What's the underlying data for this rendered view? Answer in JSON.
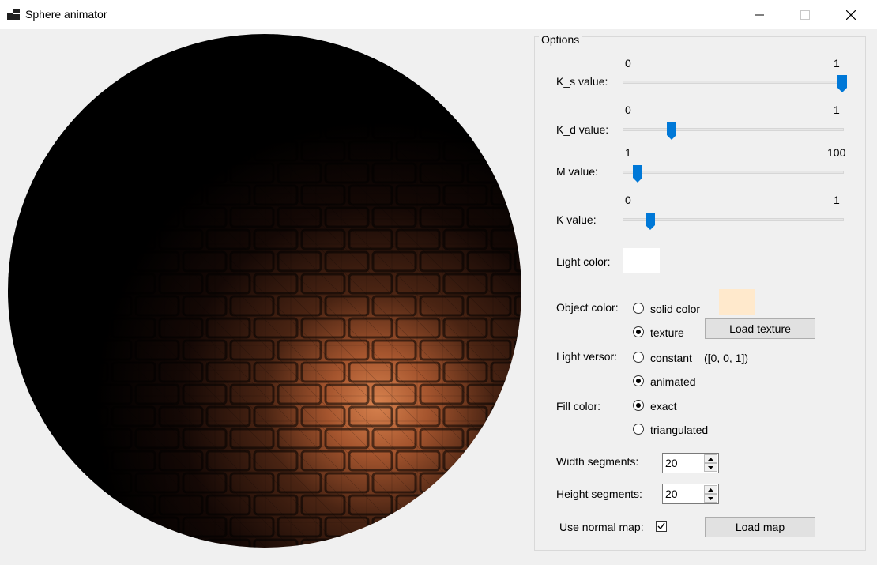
{
  "window": {
    "title": "Sphere animator",
    "controls": {
      "minimize": "—",
      "maximize": "☐",
      "close": "✕"
    }
  },
  "options": {
    "group_label": "Options",
    "sliders": [
      {
        "label": "K_s value:",
        "min_label": "0",
        "max_label": "1",
        "value": 1.0
      },
      {
        "label": "K_d value:",
        "min_label": "0",
        "max_label": "1",
        "value": 0.2
      },
      {
        "label": "M value:",
        "min_label": "1",
        "max_label": "100",
        "value": 5
      },
      {
        "label": "K value:",
        "min_label": "0",
        "max_label": "1",
        "value": 0.1
      }
    ],
    "light_color": {
      "label": "Light color:",
      "color": "#ffffff"
    },
    "object_color": {
      "label": "Object color:",
      "solid_label": "solid color",
      "solid_color": "#ffe9cc",
      "texture_label": "texture",
      "selected": "texture",
      "load_texture_label": "Load texture"
    },
    "light_versor": {
      "label": "Light versor:",
      "constant_label": "constant",
      "constant_value": "([0, 0, 1])",
      "animated_label": "animated",
      "selected": "animated"
    },
    "fill_color": {
      "label": "Fill color:",
      "exact_label": "exact",
      "triangulated_label": "triangulated",
      "selected": "exact"
    },
    "width_segments": {
      "label": "Width segments:",
      "value": "20"
    },
    "height_segments": {
      "label": "Height segments:",
      "value": "20"
    },
    "normal_map": {
      "label": "Use normal map:",
      "checked": true,
      "load_map_label": "Load map"
    }
  }
}
